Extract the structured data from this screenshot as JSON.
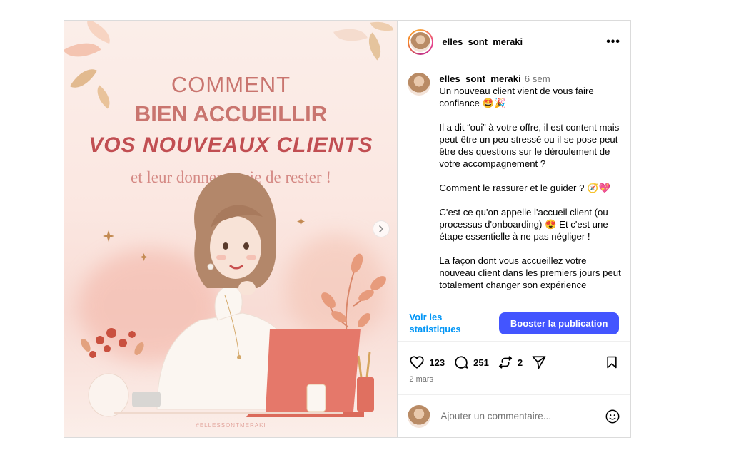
{
  "post": {
    "image": {
      "line1": "COMMENT",
      "line2": "BIEN ACCUEILLIR",
      "line3": "VOS NOUVEAUX CLIENTS",
      "line4": "et leur donner envie de rester !",
      "hashtag": "#ELLESSONTMERAKI"
    },
    "header": {
      "username": "elles_sont_meraki",
      "more_label": "•••"
    },
    "caption": {
      "username": "elles_sont_meraki",
      "time": "6 sem",
      "paragraphs": [
        "Un nouveau client vient de vous faire confiance 🤩🎉",
        "Il a dit “oui” à votre offre, il est content mais peut-être un peu stressé ou il se pose peut-être des questions sur le déroulement de votre accompagnement ?",
        "Comment le rassurer et le guider ? 🧭💖",
        "C'est ce qu'on appelle l'accueil client (ou processus d'onboarding) 😍 Et c'est une étape essentielle à ne pas négliger !",
        "La façon dont vous accueillez votre nouveau client dans les premiers jours peut totalement changer son expérience"
      ]
    },
    "insights": {
      "stats_link": "Voir les statistiques",
      "boost_label": "Booster la publication"
    },
    "engagement": {
      "likes": "123",
      "comments": "251",
      "reposts": "2",
      "date": "2 mars"
    },
    "comment_box": {
      "placeholder": "Ajouter un commentaire..."
    },
    "colors": {
      "accent": "#4355ff",
      "link": "#0095f6",
      "title_rose": "#c9756f",
      "title_red": "#c14e52"
    },
    "icons": [
      "heart-icon",
      "comment-icon",
      "repost-icon",
      "share-icon",
      "bookmark-icon",
      "emoji-icon",
      "chevron-right-icon",
      "more-icon"
    ]
  }
}
